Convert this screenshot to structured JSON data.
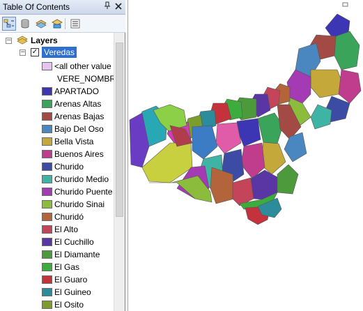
{
  "toc": {
    "title": "Table Of Contents",
    "pin_icon": "pin-icon",
    "close_icon": "close-icon",
    "toolbar": [
      {
        "name": "list-by-drawing-order-button",
        "icon": "drawing-order-icon",
        "active": true
      },
      {
        "name": "list-by-source-button",
        "icon": "source-icon",
        "active": false
      },
      {
        "name": "list-by-visibility-button",
        "icon": "visibility-icon",
        "active": false
      },
      {
        "name": "list-by-selection-button",
        "icon": "selection-icon",
        "active": false
      },
      {
        "name": "options-button",
        "icon": "options-icon",
        "active": false
      }
    ],
    "layers_label": "Layers",
    "layer": {
      "name": "Veredas",
      "checked": true,
      "other_values": "<all other value",
      "field": "VERE_NOMBR",
      "other_color": "#e6c4f0"
    },
    "classes": [
      {
        "label": "APARTADO",
        "color": "#3c36b4"
      },
      {
        "label": "Arenas Altas",
        "color": "#3aa45a"
      },
      {
        "label": "Arenas Bajas",
        "color": "#a44a44"
      },
      {
        "label": "Bajo Del Oso",
        "color": "#4a86c0"
      },
      {
        "label": "Bella Vista",
        "color": "#c4a83a"
      },
      {
        "label": "Buenos Aires",
        "color": "#c03c8c"
      },
      {
        "label": "Churido",
        "color": "#3c4ca4"
      },
      {
        "label": "Churido Medio",
        "color": "#40b4a4"
      },
      {
        "label": "Churido Puente",
        "color": "#a43ab4"
      },
      {
        "label": "Churido Sinai",
        "color": "#8cbc3c"
      },
      {
        "label": "Churidó",
        "color": "#b4643a"
      },
      {
        "label": "El Alto",
        "color": "#c4445a"
      },
      {
        "label": "El Cuchillo",
        "color": "#5a36a4"
      },
      {
        "label": "El Diamante",
        "color": "#4c9a3c"
      },
      {
        "label": "El Gas",
        "color": "#3cac3c"
      },
      {
        "label": "El Guaro",
        "color": "#c4323c"
      },
      {
        "label": "El Guineo",
        "color": "#2c8c9c"
      },
      {
        "label": "El Osito",
        "color": "#7c9c2c"
      }
    ]
  },
  "map": {
    "outline_color": "#555555"
  }
}
